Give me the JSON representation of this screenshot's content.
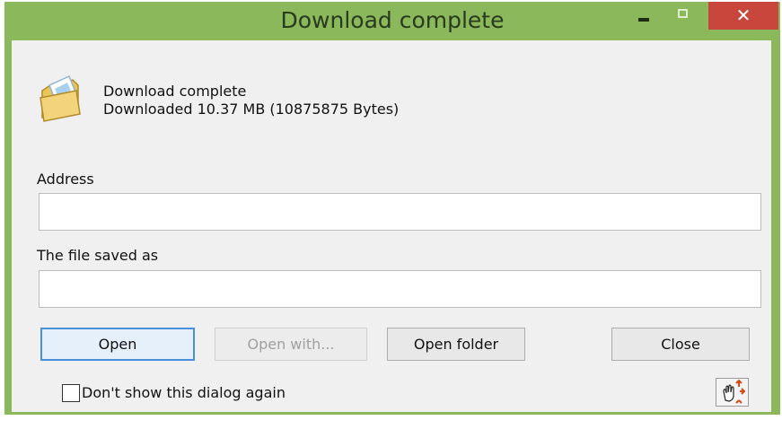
{
  "window": {
    "title": "Download complete",
    "close_glyph": "✕"
  },
  "message": {
    "line1": "Download complete",
    "line2": "Downloaded 10.37  MB (10875875 Bytes)"
  },
  "address": {
    "label": "Address",
    "value": ""
  },
  "saved_as": {
    "label": "The file saved as",
    "value": ""
  },
  "buttons": {
    "open": "Open",
    "open_with": "Open with...",
    "open_folder": "Open folder",
    "close": "Close"
  },
  "checkbox": {
    "label": "Don't show this dialog again",
    "checked": false
  },
  "icons": {
    "dialog_icon": "folder-icon",
    "move_button_icon": "hand-arrows-icon"
  },
  "colors": {
    "titlebar": "#8ab85a",
    "close_button": "#c9463d",
    "focus_border": "#4a8fd9"
  }
}
